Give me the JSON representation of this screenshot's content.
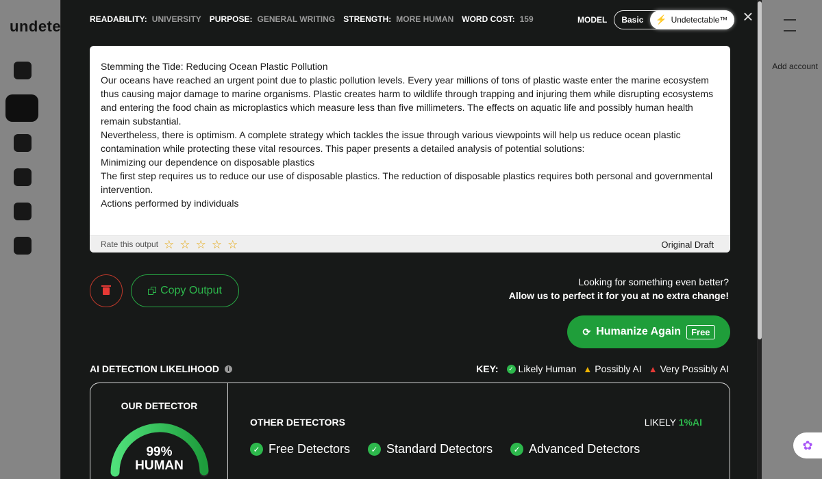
{
  "background": {
    "logo": "undete",
    "right_text": "Add account"
  },
  "settings": [
    {
      "label": "READABILITY:",
      "value": "UNIVERSITY"
    },
    {
      "label": "PURPOSE:",
      "value": "GENERAL WRITING"
    },
    {
      "label": "STRENGTH:",
      "value": "MORE HUMAN"
    },
    {
      "label": "WORD COST:",
      "value": "159"
    }
  ],
  "model": {
    "label": "MODEL",
    "basic": "Basic",
    "selected": "Undetectable™"
  },
  "output": {
    "paragraphs": [
      "Stemming the Tide: Reducing Ocean Plastic Pollution",
      "Our oceans have reached an urgent point due to plastic pollution levels. Every year millions of tons of plastic waste enter the marine ecosystem thus causing major damage to marine organisms. Plastic creates harm to wildlife through trapping and injuring them while disrupting ecosystems and entering the food chain as microplastics which measure less than five millimeters. The effects on aquatic life and possibly human health remain substantial.",
      "Nevertheless, there is optimism. A complete strategy which tackles the issue through various viewpoints will help us reduce ocean plastic contamination while protecting these vital resources. This paper presents a detailed analysis of potential solutions:",
      "Minimizing our dependence on disposable plastics",
      "The first step requires us to reduce our use of disposable plastics. The reduction of disposable plastics requires both personal and governmental intervention.",
      "Actions performed by individuals"
    ],
    "rate_label": "Rate this output",
    "draft_label": "Original Draft"
  },
  "actions": {
    "copy_label": "Copy Output",
    "better_line1": "Looking for something even better?",
    "better_line2": "Allow us to perfect it for you at no extra change!",
    "humanize_label": "Humanize Again",
    "free_label": "Free"
  },
  "ai_detection": {
    "title": "AI DETECTION LIKELIHOOD",
    "key_label": "KEY:",
    "key_items": [
      "Likely Human",
      "Possibly AI",
      "Very Possibly AI"
    ],
    "our_detector_title": "OUR DETECTOR",
    "score_pct": "99%",
    "score_label": "HUMAN",
    "score_value": 0.99,
    "other_title": "OTHER DETECTORS",
    "likely_prefix": "LIKELY",
    "likely_pct": "1%AI",
    "detectors": [
      "Free Detectors",
      "Standard Detectors",
      "Advanced Detectors"
    ]
  },
  "colors": {
    "accent_green": "#1f9e3a",
    "warning_yellow": "#f0b400",
    "danger_red": "#e53935"
  }
}
